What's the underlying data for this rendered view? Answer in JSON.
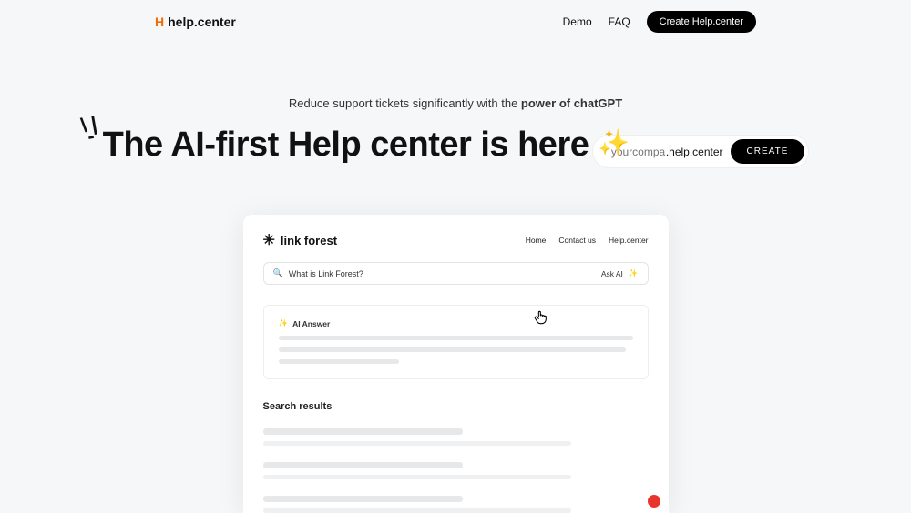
{
  "nav": {
    "logo_mark": "H",
    "logo_text": "help.center",
    "demo": "Demo",
    "faq": "FAQ",
    "create_btn": "Create Help.center"
  },
  "hero": {
    "tagline_left": "Reduce support tickets significantly with the ",
    "tagline_bold": "power of chatGPT",
    "headline": "The AI-first Help center is here",
    "input_placeholder": "yourcompany",
    "suffix": ".help.center",
    "submit": "CREATE"
  },
  "preview": {
    "brand": "link forest",
    "nav": {
      "home": "Home",
      "contact": "Contact us",
      "help": "Help.center"
    },
    "search_query": "What is Link Forest?",
    "ask_ai": "Ask AI",
    "ai_answer_label": "AI Answer",
    "results_title": "Search results"
  }
}
